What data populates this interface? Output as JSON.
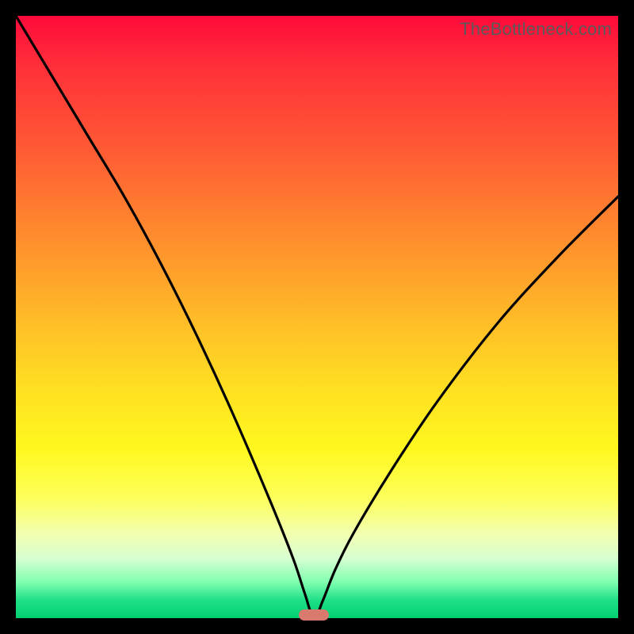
{
  "watermark": "TheBottleneck.com",
  "colors": {
    "frame": "#000000",
    "marker": "#d87a6e",
    "curve": "#000000"
  },
  "chart_data": {
    "type": "line",
    "title": "",
    "xlabel": "",
    "ylabel": "",
    "xlim": [
      0,
      100
    ],
    "ylim": [
      0,
      100
    ],
    "grid": false,
    "series": [
      {
        "name": "bottleneck-curve",
        "x": [
          0,
          6,
          12,
          18,
          24,
          30,
          36,
          42,
          46,
          48,
          49.5,
          51,
          53,
          56,
          62,
          70,
          80,
          90,
          100
        ],
        "values": [
          100,
          90,
          80,
          70,
          59,
          47,
          34,
          20,
          10,
          4,
          0,
          3,
          8,
          14,
          24,
          36,
          49,
          60,
          70
        ]
      }
    ],
    "annotations": [
      {
        "type": "marker",
        "shape": "pill",
        "x": 49.5,
        "y": 0,
        "color": "#d87a6e"
      }
    ],
    "background_gradient": {
      "direction": "top-to-bottom",
      "stops": [
        {
          "pos": 0,
          "color": "#ff0a3a"
        },
        {
          "pos": 50,
          "color": "#ffba28"
        },
        {
          "pos": 80,
          "color": "#fdff5a"
        },
        {
          "pos": 100,
          "color": "#00d070"
        }
      ]
    }
  }
}
